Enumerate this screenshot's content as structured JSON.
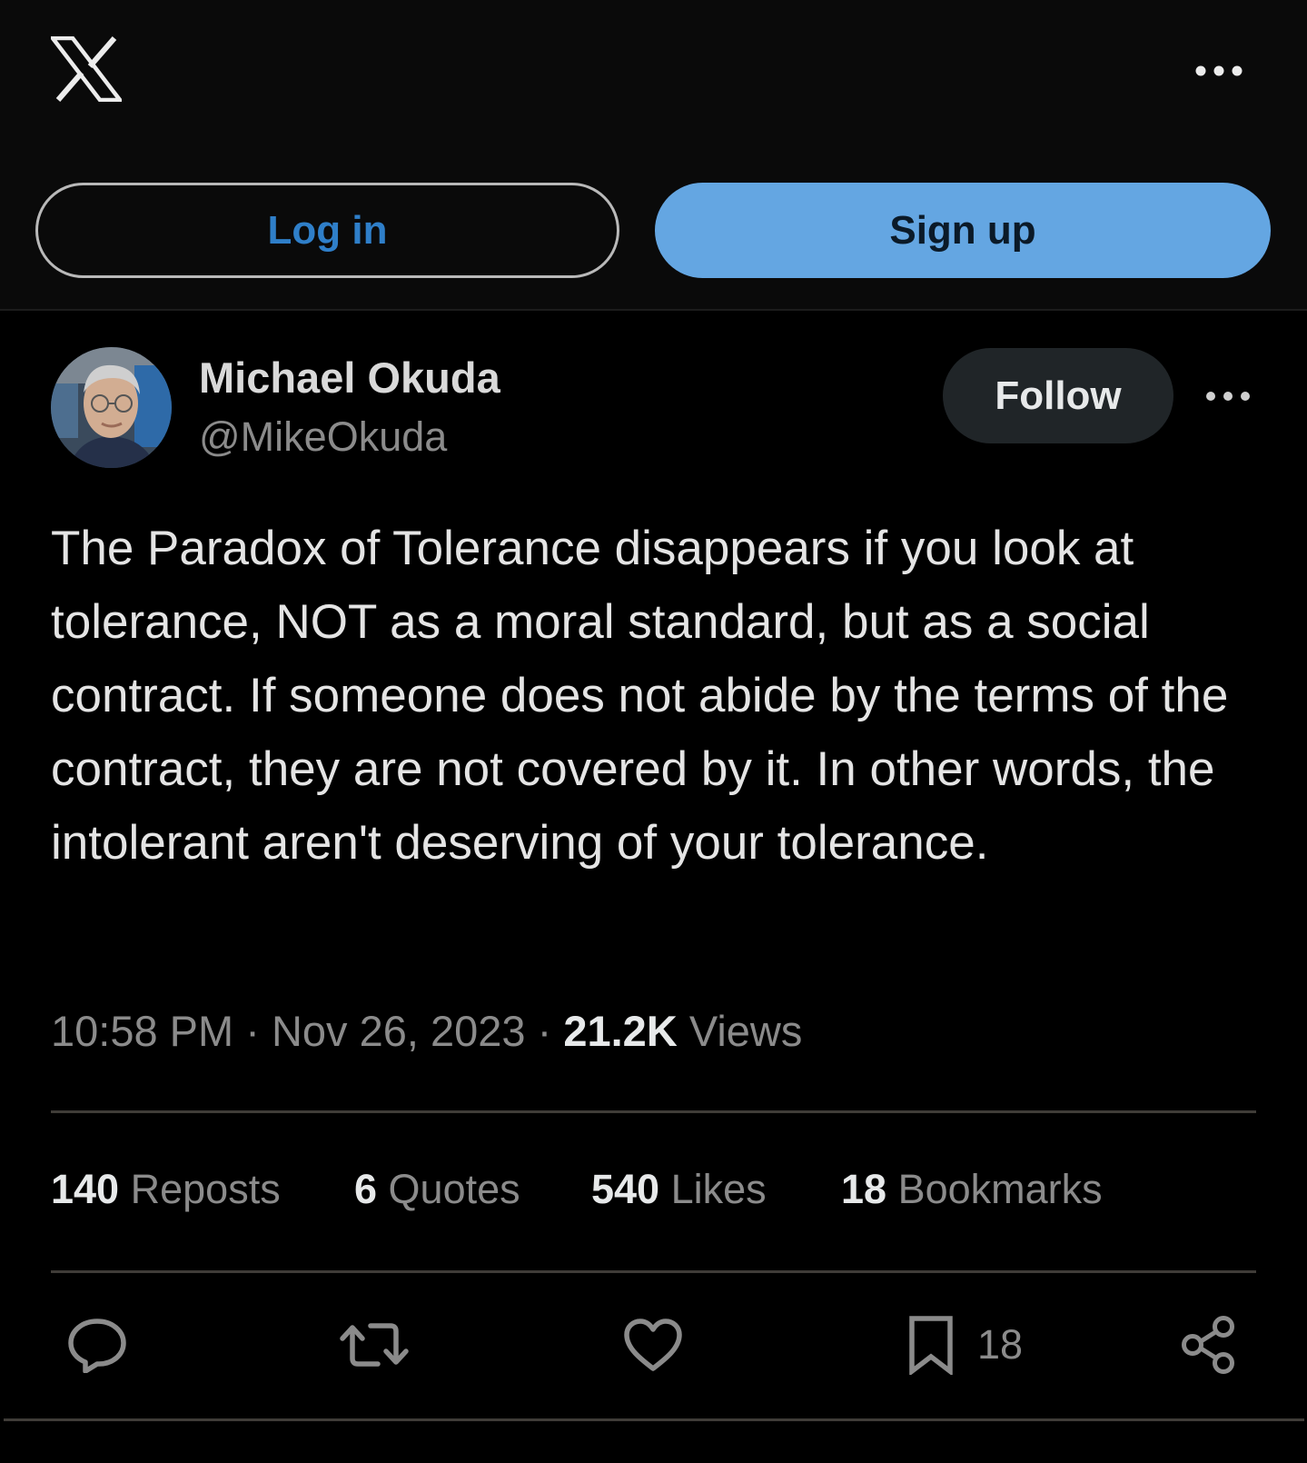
{
  "header": {
    "login_label": "Log in",
    "signup_label": "Sign up"
  },
  "author": {
    "name": "Michael Okuda",
    "handle": "@MikeOkuda",
    "follow_label": "Follow"
  },
  "post": {
    "text": "The Paradox of Tolerance disappears if you look at tolerance, NOT as a moral standard, but as a social contract. If someone does not abide by the terms of the contract, they are not covered by it. In other words, the intolerant aren't deserving of your tolerance.",
    "time": "10:58 PM",
    "date": "Nov 26, 2023",
    "views_count": "21.2K",
    "views_label": "Views"
  },
  "stats": {
    "reposts_count": "140",
    "reposts_label": "Reposts",
    "quotes_count": "6",
    "quotes_label": "Quotes",
    "likes_count": "540",
    "likes_label": "Likes",
    "bookmarks_count": "18",
    "bookmarks_label": "Bookmarks"
  },
  "actions": {
    "bookmark_count": "18"
  },
  "icons": [
    "x-logo-icon",
    "more-icon",
    "reply-icon",
    "repost-icon",
    "like-icon",
    "bookmark-icon",
    "share-icon"
  ],
  "colors": {
    "background": "#000000",
    "header_background": "#0a0a0a",
    "signup_button": "#64a6e2",
    "login_text": "#2f7fc9",
    "follow_button": "#202528",
    "secondary_text": "#8b8b8b"
  }
}
